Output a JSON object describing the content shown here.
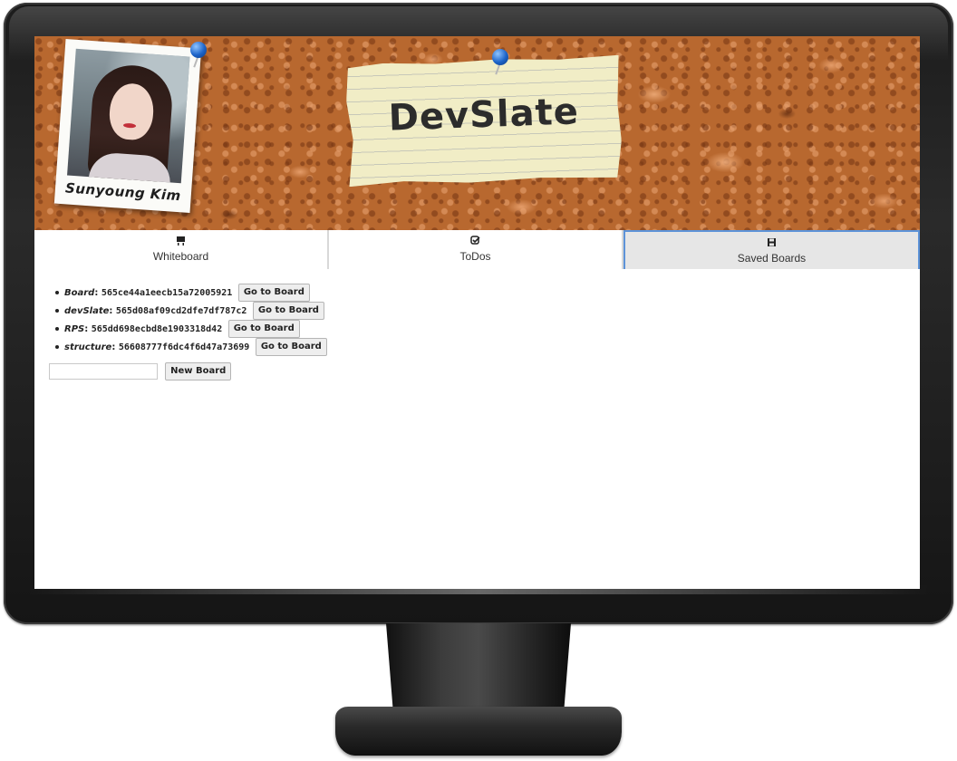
{
  "header": {
    "profile_name": "Sunyoung Kim",
    "app_title": "DevSlate"
  },
  "tabs": [
    {
      "label": "Whiteboard",
      "icon": "whiteboard-icon",
      "active": false
    },
    {
      "label": "ToDos",
      "icon": "check-square-icon",
      "active": false
    },
    {
      "label": "Saved Boards",
      "icon": "save-icon",
      "active": true
    }
  ],
  "boards": {
    "items": [
      {
        "name": "Board",
        "id": "565ce44a1eecb15a72005921"
      },
      {
        "name": "devSlate",
        "id": "565d08af09cd2dfe7df787c2"
      },
      {
        "name": "RPS",
        "id": "565dd698ecbd8e1903318d42"
      },
      {
        "name": "structure",
        "id": "56608777f6dc4f6d47a73699"
      }
    ],
    "go_label": "Go to Board",
    "new_board_label": "New Board",
    "new_board_value": ""
  },
  "colors": {
    "active_tab_border": "#5d93d8",
    "cork": "#b8682f",
    "note": "#f1edc6"
  }
}
